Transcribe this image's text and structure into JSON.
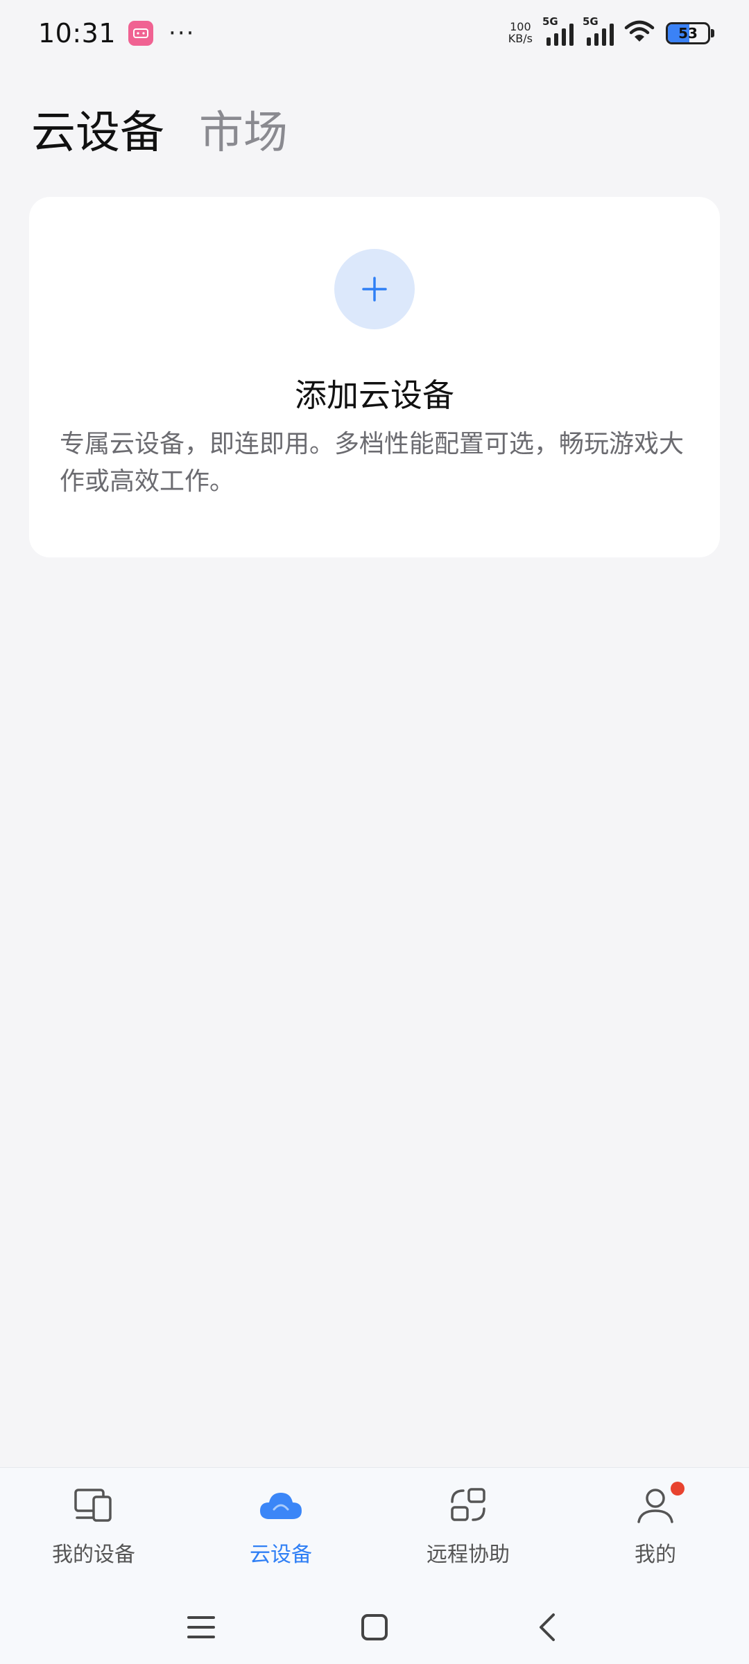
{
  "status_bar": {
    "time": "10:31",
    "network_speed_value": "100",
    "network_speed_unit": "KB/s",
    "signal_1_label": "5G",
    "signal_2_label": "5G",
    "battery_level": "53",
    "battery_percent": 53
  },
  "header": {
    "tabs": [
      {
        "label": "云设备",
        "active": true
      },
      {
        "label": "市场",
        "active": false
      }
    ]
  },
  "card": {
    "add_icon": "plus-icon",
    "title": "添加云设备",
    "description": "专属云设备，即连即用。多档性能配置可选，畅玩游戏大作或高效工作。"
  },
  "bottom_nav": {
    "items": [
      {
        "label": "我的设备",
        "icon": "devices-icon",
        "active": false
      },
      {
        "label": "云设备",
        "icon": "cloud-icon",
        "active": true
      },
      {
        "label": "远程协助",
        "icon": "remote-assist-icon",
        "active": false
      },
      {
        "label": "我的",
        "icon": "person-icon",
        "active": false,
        "badge": true
      }
    ]
  },
  "system_nav": {
    "buttons": [
      "menu-icon",
      "home-icon",
      "back-icon"
    ]
  },
  "colors": {
    "accent": "#2f7ff5",
    "background": "#f5f5f7",
    "card": "#ffffff",
    "add_circle": "#dce8fb",
    "badge": "#e8432f"
  }
}
